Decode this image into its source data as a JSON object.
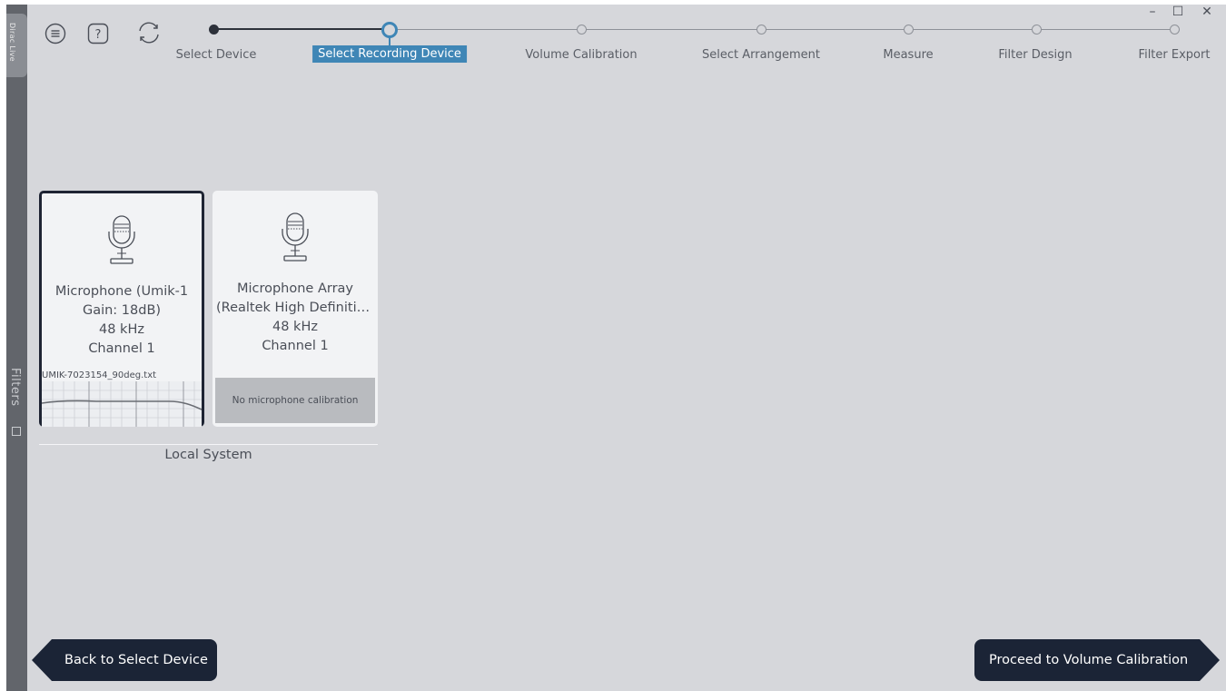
{
  "app": {
    "side_tab_label": "Dirac Live",
    "side_filters_label": "Filters"
  },
  "toolbar": {
    "menu_icon": "menu-icon",
    "help_icon": "help-icon",
    "refresh_icon": "refresh-icon",
    "help_glyph": "?"
  },
  "window_controls": {
    "minimize": "–",
    "maximize": "☐",
    "close": "✕"
  },
  "stepper": {
    "steps": [
      {
        "label": "Select Device",
        "state": "done"
      },
      {
        "label": "Select Recording Device",
        "state": "active"
      },
      {
        "label": "Volume Calibration",
        "state": "pending"
      },
      {
        "label": "Select Arrangement",
        "state": "pending"
      },
      {
        "label": "Measure",
        "state": "pending"
      },
      {
        "label": "Filter Design",
        "state": "pending"
      },
      {
        "label": "Filter Export",
        "state": "pending"
      }
    ]
  },
  "devices": [
    {
      "name_line1": "Microphone (Umik-1",
      "name_line2": "Gain: 18dB)",
      "rate": "48 kHz",
      "channel": "Channel 1",
      "calibration_file": "UMIK-7023154_90deg.txt",
      "selected": true
    },
    {
      "name_line1": "Microphone Array",
      "name_line2": "(Realtek High Definition Audio)",
      "rate": "48 kHz",
      "channel": "Channel 1",
      "calibration_status": "No microphone calibration",
      "selected": false
    }
  ],
  "group": {
    "label": "Local System"
  },
  "navigation": {
    "back_label": "Back to Select Device",
    "next_label": "Proceed to Volume Calibration"
  },
  "colors": {
    "accent": "#3f86b6",
    "button_bg": "#1b2436",
    "background": "#d6d7db"
  }
}
